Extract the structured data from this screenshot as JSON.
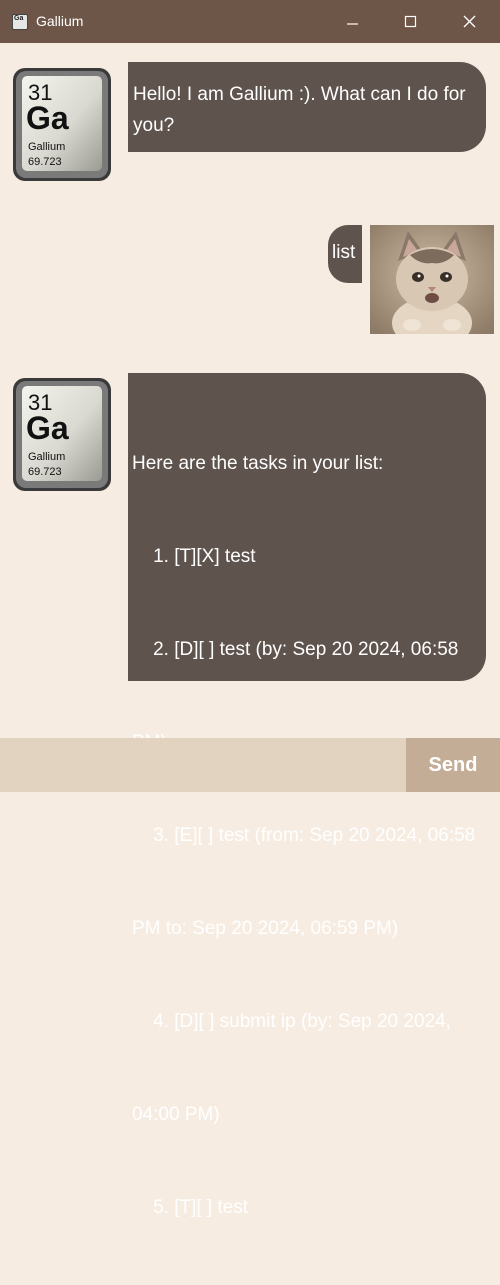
{
  "window": {
    "title": "Gallium",
    "icon": "gallium-app-icon"
  },
  "avatar": {
    "number": "31",
    "symbol": "Ga",
    "name": "Gallium",
    "mass": "69.723"
  },
  "messages": [
    {
      "sender": "bot",
      "lines": [
        "Hello! I am Gallium :). What can I do for",
        "you?"
      ]
    },
    {
      "sender": "user",
      "text": "list",
      "image": "kitten-photo"
    },
    {
      "sender": "bot",
      "lines": [
        "Here are the tasks in your list:",
        "    1. [T][X] test",
        "    2. [D][ ] test (by: Sep 20 2024, 06:58",
        "PM)",
        "    3. [E][ ] test (from: Sep 20 2024, 06:58",
        "PM to: Sep 20 2024, 06:59 PM)",
        "    4. [D][ ] submit ip (by: Sep 20 2024,",
        "04:00 PM)",
        "    5. [T][ ] test"
      ]
    }
  ],
  "input": {
    "value": "",
    "placeholder": ""
  },
  "send_label": "Send",
  "colors": {
    "titlebar": "#6d5647",
    "background": "#f6ece1",
    "bubble": "#5e534d",
    "input": "#e2d3c1",
    "send": "#c4ad97"
  }
}
